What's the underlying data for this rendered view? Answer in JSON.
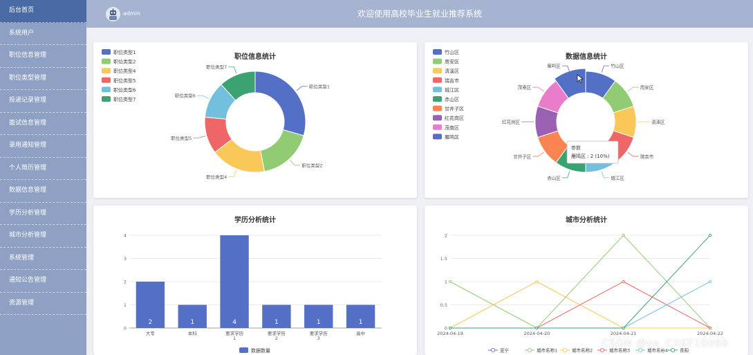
{
  "sidebar": {
    "items": [
      {
        "label": "后台首页",
        "active": true
      },
      {
        "label": "系统用户"
      },
      {
        "label": "职位信息管理"
      },
      {
        "label": "职位类型管理"
      },
      {
        "label": "投递记录管理"
      },
      {
        "label": "面试信息管理"
      },
      {
        "label": "录用通知管理"
      },
      {
        "label": "个人简历管理"
      },
      {
        "label": "数据信息管理"
      },
      {
        "label": "学历分析管理"
      },
      {
        "label": "城市分析管理"
      },
      {
        "label": "系统管理"
      },
      {
        "label": "通知公告管理"
      },
      {
        "label": "资源管理"
      }
    ]
  },
  "header": {
    "username": "admin",
    "title": "欢迎使用高校毕业生就业推荐系统"
  },
  "watermark": "CSDN @yx_CXKF10088",
  "colors": [
    "#5470c6",
    "#91cc75",
    "#fac858",
    "#ee6666",
    "#73c0de",
    "#3ba272",
    "#fc8452",
    "#9a60b4",
    "#ea7ccc"
  ],
  "chart_data": [
    {
      "type": "pie",
      "variant": "donut",
      "title": "职位信息统计",
      "legend_position": "top-left",
      "categories": [
        "职位类型1",
        "职位类型2",
        "职位类型4",
        "职位类型5",
        "职位类型6",
        "职位类型7"
      ],
      "legend_labels": [
        "职位类型1",
        "职位类型2",
        "职位类型4",
        "职位类型5",
        "职位类型6",
        "职位类型7"
      ],
      "slice_labels": [
        "职位类型1",
        "职位类型2",
        "职位类型4",
        "职位类型5",
        "职位类型6",
        "职位类型7"
      ],
      "values": [
        5,
        3,
        3,
        2,
        2,
        2
      ],
      "color_indices": [
        0,
        1,
        2,
        3,
        4,
        5
      ]
    },
    {
      "type": "pie",
      "variant": "donut",
      "title": "数据信息统计",
      "legend_position": "top-left",
      "categories": [
        "竹山区",
        "周安区",
        "清溪区",
        "瑞吉市",
        "城江区",
        "赤山区",
        "甘井子区",
        "红花岗区",
        "茂南区",
        "雁鸣区"
      ],
      "values": [
        2,
        2,
        2,
        2,
        2,
        2,
        2,
        2,
        2,
        2
      ],
      "color_indices": [
        0,
        1,
        2,
        3,
        4,
        5,
        6,
        7,
        8,
        0
      ],
      "highlight_index": 9,
      "tooltip": {
        "title": "参数",
        "text": "雁鸣区 : 2 (10%)"
      }
    },
    {
      "type": "bar",
      "title": "学历分析统计",
      "categories": [
        "大专",
        "本科",
        "要求学历1",
        "要求学历2",
        "要求学历3",
        "高中"
      ],
      "category_lines": [
        [
          "大专"
        ],
        [
          "本科"
        ],
        [
          "要求学历",
          "1"
        ],
        [
          "要求学历",
          "2"
        ],
        [
          "要求学历",
          "3"
        ],
        [
          "高中"
        ]
      ],
      "values": [
        2,
        1,
        4,
        1,
        1,
        1
      ],
      "series_name": "数据数量",
      "ylim": [
        0,
        4
      ],
      "yticks": [
        "0",
        "1",
        "2",
        "3",
        "4"
      ],
      "legend_position": "bottom"
    },
    {
      "type": "line",
      "title": "城市分析统计",
      "x": [
        "2024-04-19",
        "2024-04-20",
        "2024-04-21",
        "2024-04-22"
      ],
      "ylim": [
        0,
        2
      ],
      "yticks": [
        "0",
        "0.5",
        "1",
        "1.5",
        "2"
      ],
      "legend_position": "bottom",
      "series": [
        {
          "name": "宽宁",
          "values": [
            0,
            0,
            0,
            0
          ],
          "color_index": 0
        },
        {
          "name": "城市名称1",
          "values": [
            1,
            0,
            2,
            0
          ],
          "color_index": 1
        },
        {
          "name": "城市名称2",
          "values": [
            0,
            1,
            0,
            0
          ],
          "color_index": 2
        },
        {
          "name": "城市名称3",
          "values": [
            0,
            0,
            1,
            0
          ],
          "color_index": 3
        },
        {
          "name": "城市名称4",
          "values": [
            0,
            0,
            0,
            1
          ],
          "color_index": 4
        },
        {
          "name": "贵阳",
          "values": [
            0,
            0,
            0,
            2
          ],
          "color_index": 5
        }
      ]
    }
  ]
}
